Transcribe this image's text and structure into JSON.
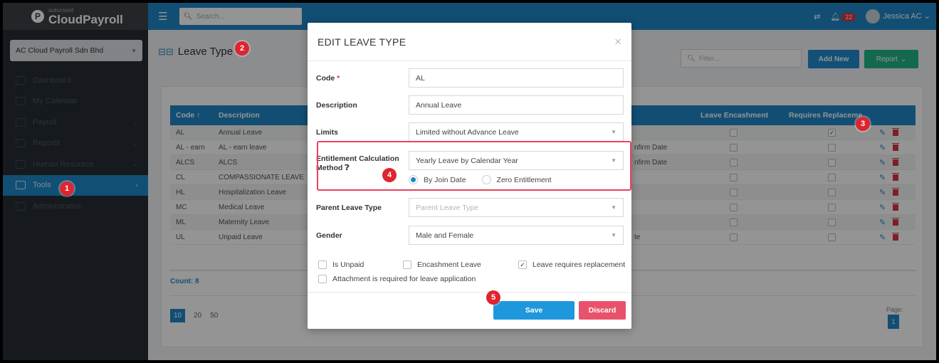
{
  "app": {
    "logo_small": "autocount",
    "logo_big": "CloudPayroll",
    "logo_letter": "P"
  },
  "sidebar": {
    "company": "AC Cloud Payroll Sdn Bhd",
    "items": [
      {
        "label": "Dashboard",
        "has_arrow": false
      },
      {
        "label": "My Calendar",
        "has_arrow": false
      },
      {
        "label": "Payroll",
        "has_arrow": true
      },
      {
        "label": "Reports",
        "has_arrow": true
      },
      {
        "label": "Human Resource",
        "has_arrow": true
      },
      {
        "label": "Tools",
        "has_arrow": true,
        "active": true
      },
      {
        "label": "Administration",
        "has_arrow": false
      }
    ]
  },
  "topbar": {
    "search_placeholder": "Search...",
    "notification_count": "22",
    "user_name": "Jessica AC"
  },
  "page": {
    "title": "Leave Type",
    "filter_placeholder": "Filter...",
    "add_new": "Add New",
    "report": "Report"
  },
  "table": {
    "headers": {
      "code": "Code",
      "description": "Description",
      "leave_encashment": "Leave Encashment",
      "requires_replacement": "Requires Replaceme"
    },
    "rows": [
      {
        "code": "AL",
        "description": "Annual Leave",
        "extra": "",
        "encash": false,
        "replace": true
      },
      {
        "code": "AL - earn",
        "description": "AL - earn leave",
        "extra": "nfirm Date",
        "encash": false,
        "replace": false
      },
      {
        "code": "ALCS",
        "description": "ALCS",
        "extra": "nfirm Date",
        "encash": false,
        "replace": false
      },
      {
        "code": "CL",
        "description": "COMPASSIONATE LEAVE",
        "extra": "",
        "encash": false,
        "replace": false
      },
      {
        "code": "HL",
        "description": "Hospitalization Leave",
        "extra": "",
        "encash": false,
        "replace": false
      },
      {
        "code": "MC",
        "description": "Medical Leave",
        "extra": "",
        "encash": false,
        "replace": false
      },
      {
        "code": "ML",
        "description": "Maternity Leave",
        "extra": "",
        "encash": false,
        "replace": false
      },
      {
        "code": "UL",
        "description": "Unpaid Leave",
        "extra": "te",
        "encash": false,
        "replace": false
      }
    ],
    "count": "Count: 8",
    "page_sizes": [
      "10",
      "20",
      "50"
    ],
    "page_label": "Page:",
    "page_number": "1"
  },
  "modal": {
    "title": "EDIT LEAVE TYPE",
    "close": "×",
    "code_label": "Code",
    "code_required": "*",
    "code_value": "AL",
    "description_label": "Description",
    "description_value": "Annual Leave",
    "limits_label": "Limits",
    "limits_value": "Limited without Advance Leave",
    "entitlement_label_1": "Entitlement Calculation",
    "entitlement_label_2": "Method",
    "entitlement_value": "Yearly Leave by Calendar Year",
    "radio_join": "By Join Date",
    "radio_zero": "Zero Entitlement",
    "parent_label": "Parent Leave Type",
    "parent_placeholder": "Parent Leave Type",
    "gender_label": "Gender",
    "gender_value": "Male and Female",
    "cb_unpaid": "Is Unpaid",
    "cb_encashment": "Encashment Leave",
    "cb_replacement": "Leave requires replacement",
    "cb_attachment": "Attachment is required for leave application",
    "save": "Save",
    "discard": "Discard"
  },
  "steps": [
    "1",
    "2",
    "3",
    "4",
    "5"
  ],
  "colors": {
    "primary": "#1f87c7",
    "sidebar": "#272c33",
    "report": "#24b38b",
    "discard": "#e8536b",
    "step": "#e0242f"
  }
}
